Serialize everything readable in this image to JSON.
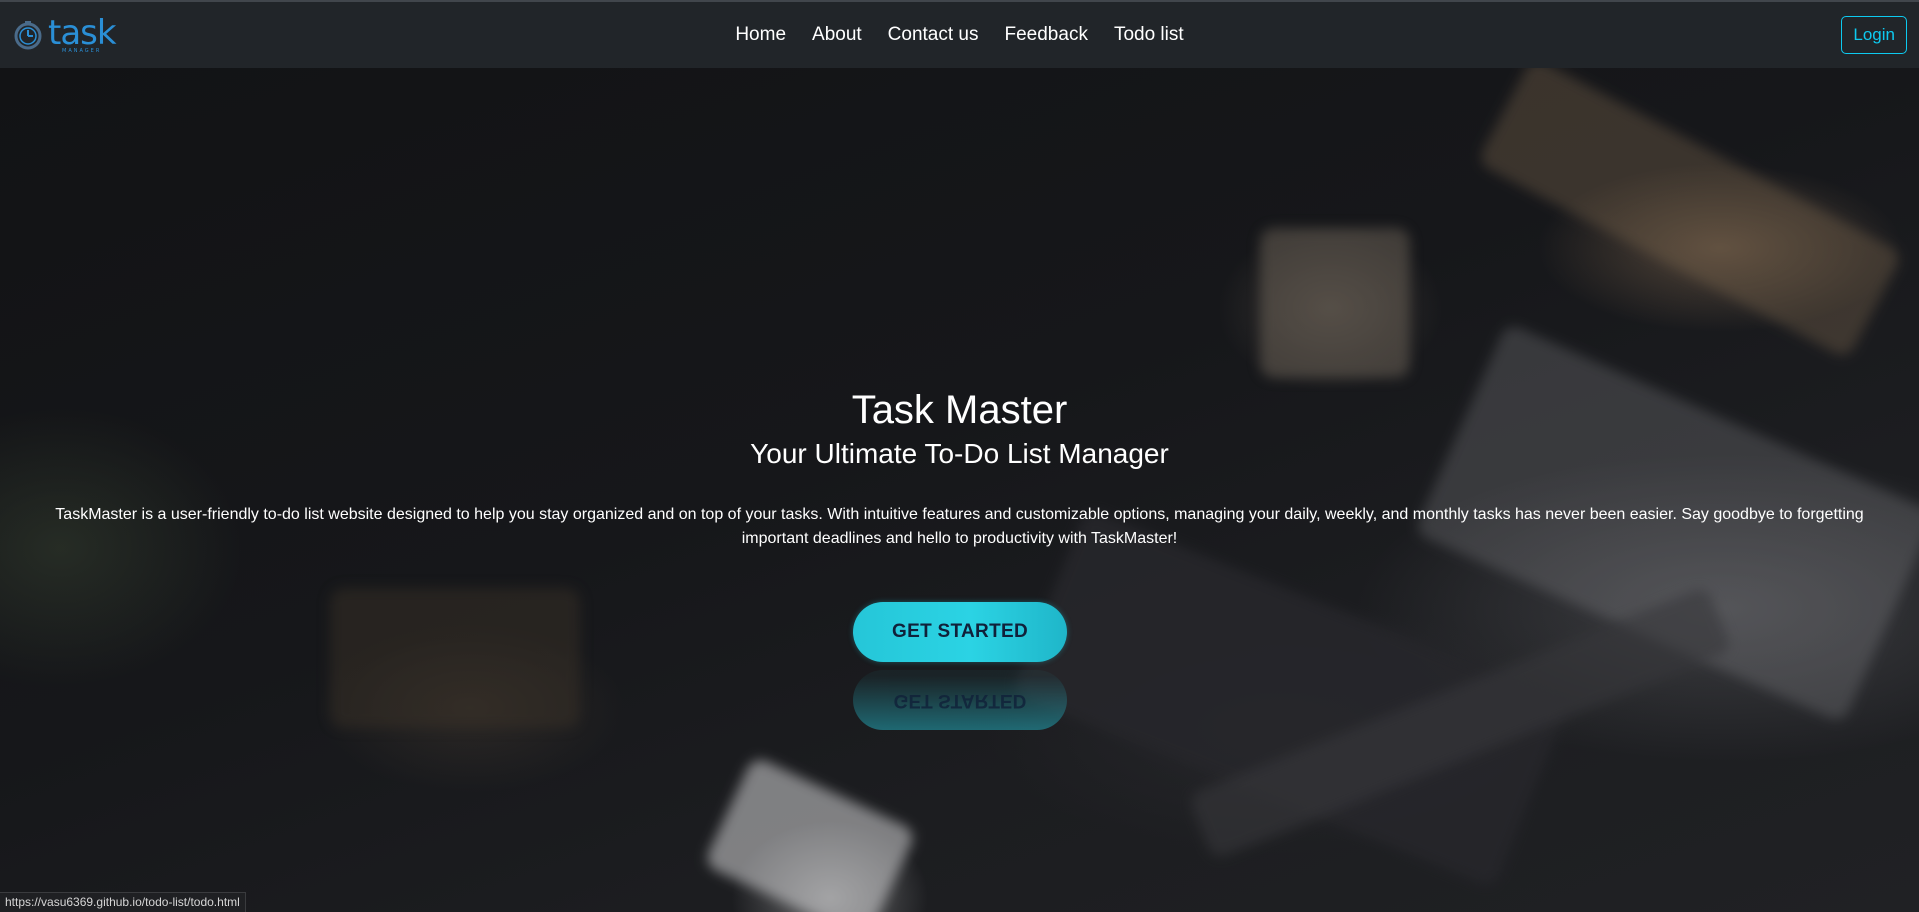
{
  "brand": {
    "logo_text": "task",
    "logo_subtext": "MANAGER"
  },
  "nav": {
    "items": [
      {
        "label": "Home"
      },
      {
        "label": "About"
      },
      {
        "label": "Contact us"
      },
      {
        "label": "Feedback"
      },
      {
        "label": "Todo list"
      }
    ],
    "login_label": "Login"
  },
  "hero": {
    "title": "Task Master",
    "subtitle": "Your Ultimate To-Do List Manager",
    "description": "TaskMaster is a user-friendly to-do list website designed to help you stay organized and on top of your tasks. With intuitive features and customizable options, managing your daily, weekly, and monthly tasks has never been easier. Say goodbye to forgetting important deadlines and hello to productivity with TaskMaster!",
    "cta_label": "GET STARTED"
  },
  "status_bar": {
    "url": "https://vasu6369.github.io/todo-list/todo.html"
  },
  "colors": {
    "navbar": "#212529",
    "accent": "#0dcaf0",
    "cta": "#25c6d8",
    "logo": "#2a8fd6"
  }
}
